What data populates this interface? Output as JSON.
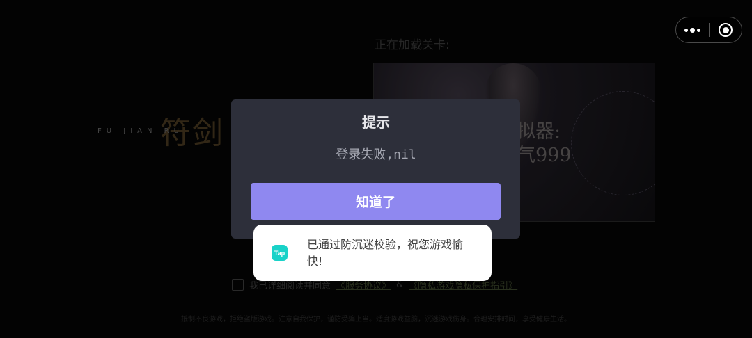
{
  "background": {
    "loading_text": "正在加载关卡:",
    "logo_title": "符剑",
    "logo_latin": "FU JIAN    RU",
    "banner_text": "拟器:\n气999",
    "terms": {
      "prefix": "我已详细阅读并同意",
      "link1": "《服务协议》",
      "amp": "&",
      "link2": "《隐私游戏隐私保护指引》"
    },
    "footer": "抵制不良游戏，拒绝盗版游戏。注意自我保护，谨防受骗上当。适度游戏益脑，沉迷游戏伤身。合理安排时间，享受健康生活。"
  },
  "capsule": {
    "more_icon": "more-dots-icon",
    "close_icon": "target-close-icon"
  },
  "modal": {
    "title": "提示",
    "message": "登录失败,nil",
    "confirm_label": "知道了",
    "confirm_color": "#8f88f0"
  },
  "toast": {
    "icon_label": "Tap",
    "icon_color": "#19d2c8",
    "text": "已通过防沉迷校验，祝您游戏愉快!"
  }
}
